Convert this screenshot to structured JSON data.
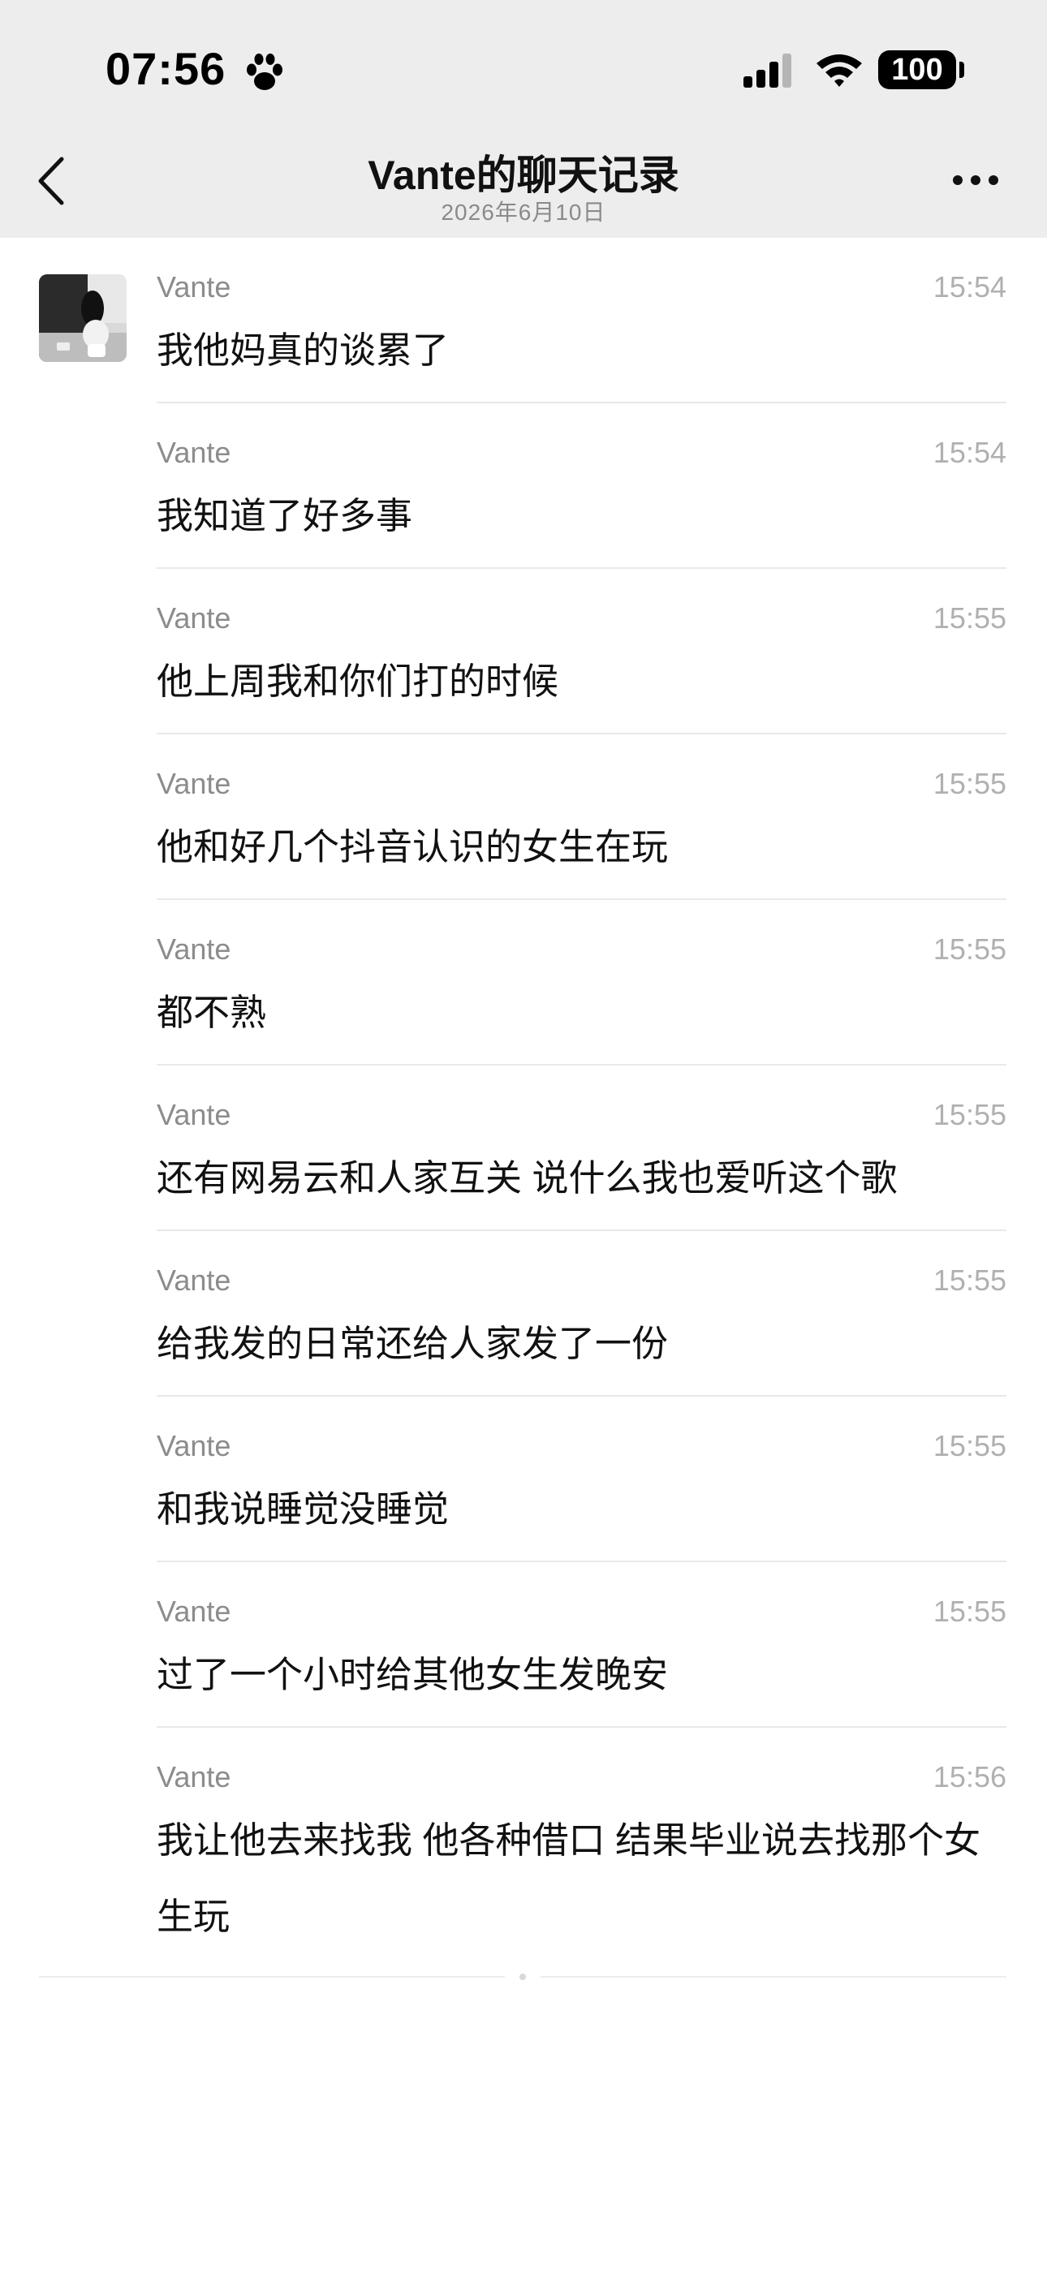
{
  "status_bar": {
    "time": "07:56",
    "battery": "100"
  },
  "header": {
    "title": "Vante的聊天记录",
    "date": "2026年6月10日"
  },
  "messages": [
    {
      "sender": "Vante",
      "time": "15:54",
      "text": "我他妈真的谈累了"
    },
    {
      "sender": "Vante",
      "time": "15:54",
      "text": "我知道了好多事"
    },
    {
      "sender": "Vante",
      "time": "15:55",
      "text": "他上周我和你们打的时候"
    },
    {
      "sender": "Vante",
      "time": "15:55",
      "text": "他和好几个抖音认识的女生在玩"
    },
    {
      "sender": "Vante",
      "time": "15:55",
      "text": "都不熟"
    },
    {
      "sender": "Vante",
      "time": "15:55",
      "text": "还有网易云和人家互关 说什么我也爱听这个歌"
    },
    {
      "sender": "Vante",
      "time": "15:55",
      "text": "给我发的日常还给人家发了一份"
    },
    {
      "sender": "Vante",
      "time": "15:55",
      "text": "和我说睡觉没睡觉"
    },
    {
      "sender": "Vante",
      "time": "15:55",
      "text": "过了一个小时给其他女生发晚安"
    },
    {
      "sender": "Vante",
      "time": "15:56",
      "text": "我让他去来找我 他各种借口 结果毕业说去找那个女生玩"
    }
  ]
}
